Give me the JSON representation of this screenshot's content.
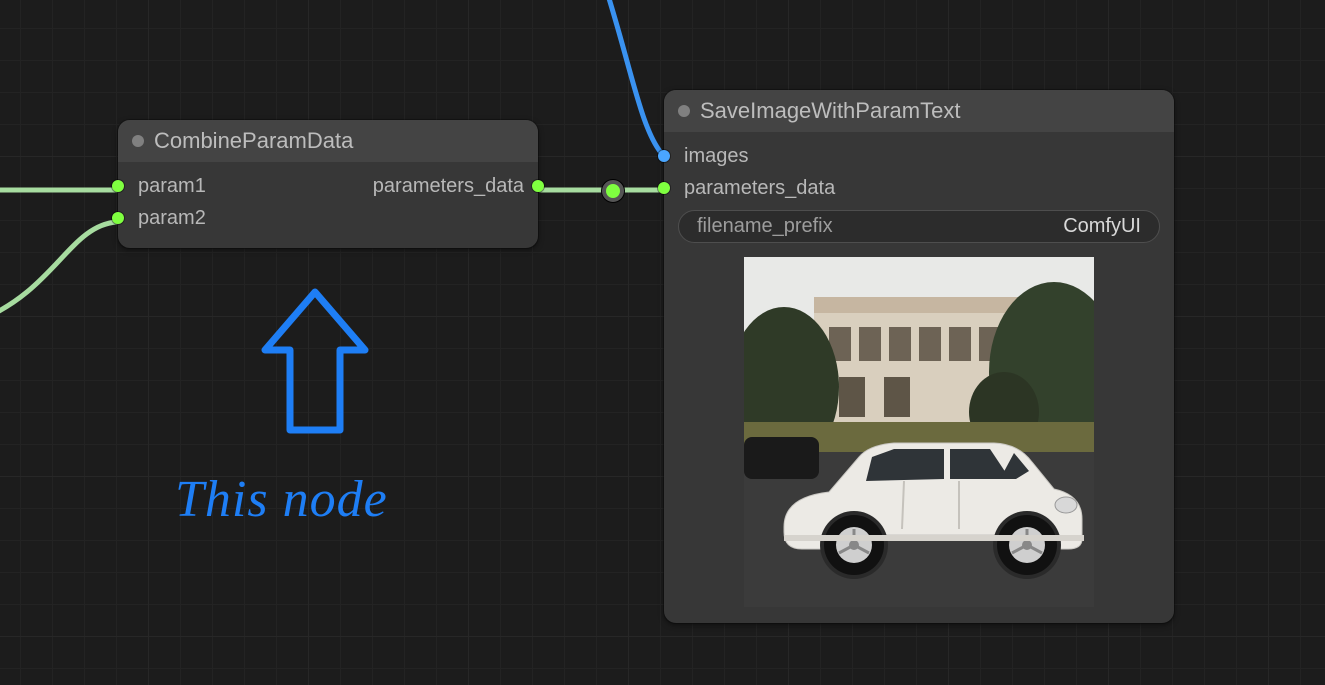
{
  "node1": {
    "title": "CombineParamData",
    "inputs": {
      "param1": "param1",
      "param2": "param2"
    },
    "outputs": {
      "parameters_data": "parameters_data"
    }
  },
  "node2": {
    "title": "SaveImageWithParamText",
    "inputs": {
      "images": "images",
      "parameters_data": "parameters_data"
    },
    "widgets": {
      "filename_prefix_label": "filename_prefix",
      "filename_prefix_value": "ComfyUI"
    }
  },
  "annotation": {
    "text": "This node"
  },
  "ports": {
    "green": "#7fff40",
    "blue": "#4aa6ff"
  }
}
